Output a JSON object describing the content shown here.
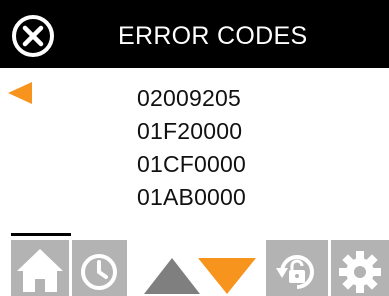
{
  "header": {
    "title": "ERROR CODES",
    "close_icon": "close-circle-icon"
  },
  "list": {
    "selected_index": 0,
    "codes": [
      "02009205",
      "01F20000",
      "01CF0000",
      "01AB0000"
    ]
  },
  "toolbar": {
    "home_icon": "home-icon",
    "history_icon": "clock-icon",
    "up_icon": "triangle-up-icon",
    "down_icon": "triangle-down-icon",
    "unlock_icon": "unlock-icon",
    "settings_icon": "gear-icon"
  },
  "colors": {
    "header_bg": "#000000",
    "accent": "#f7941d",
    "tile_bg": "#b3b3b3",
    "arrow_gray": "#7f7f7f"
  }
}
